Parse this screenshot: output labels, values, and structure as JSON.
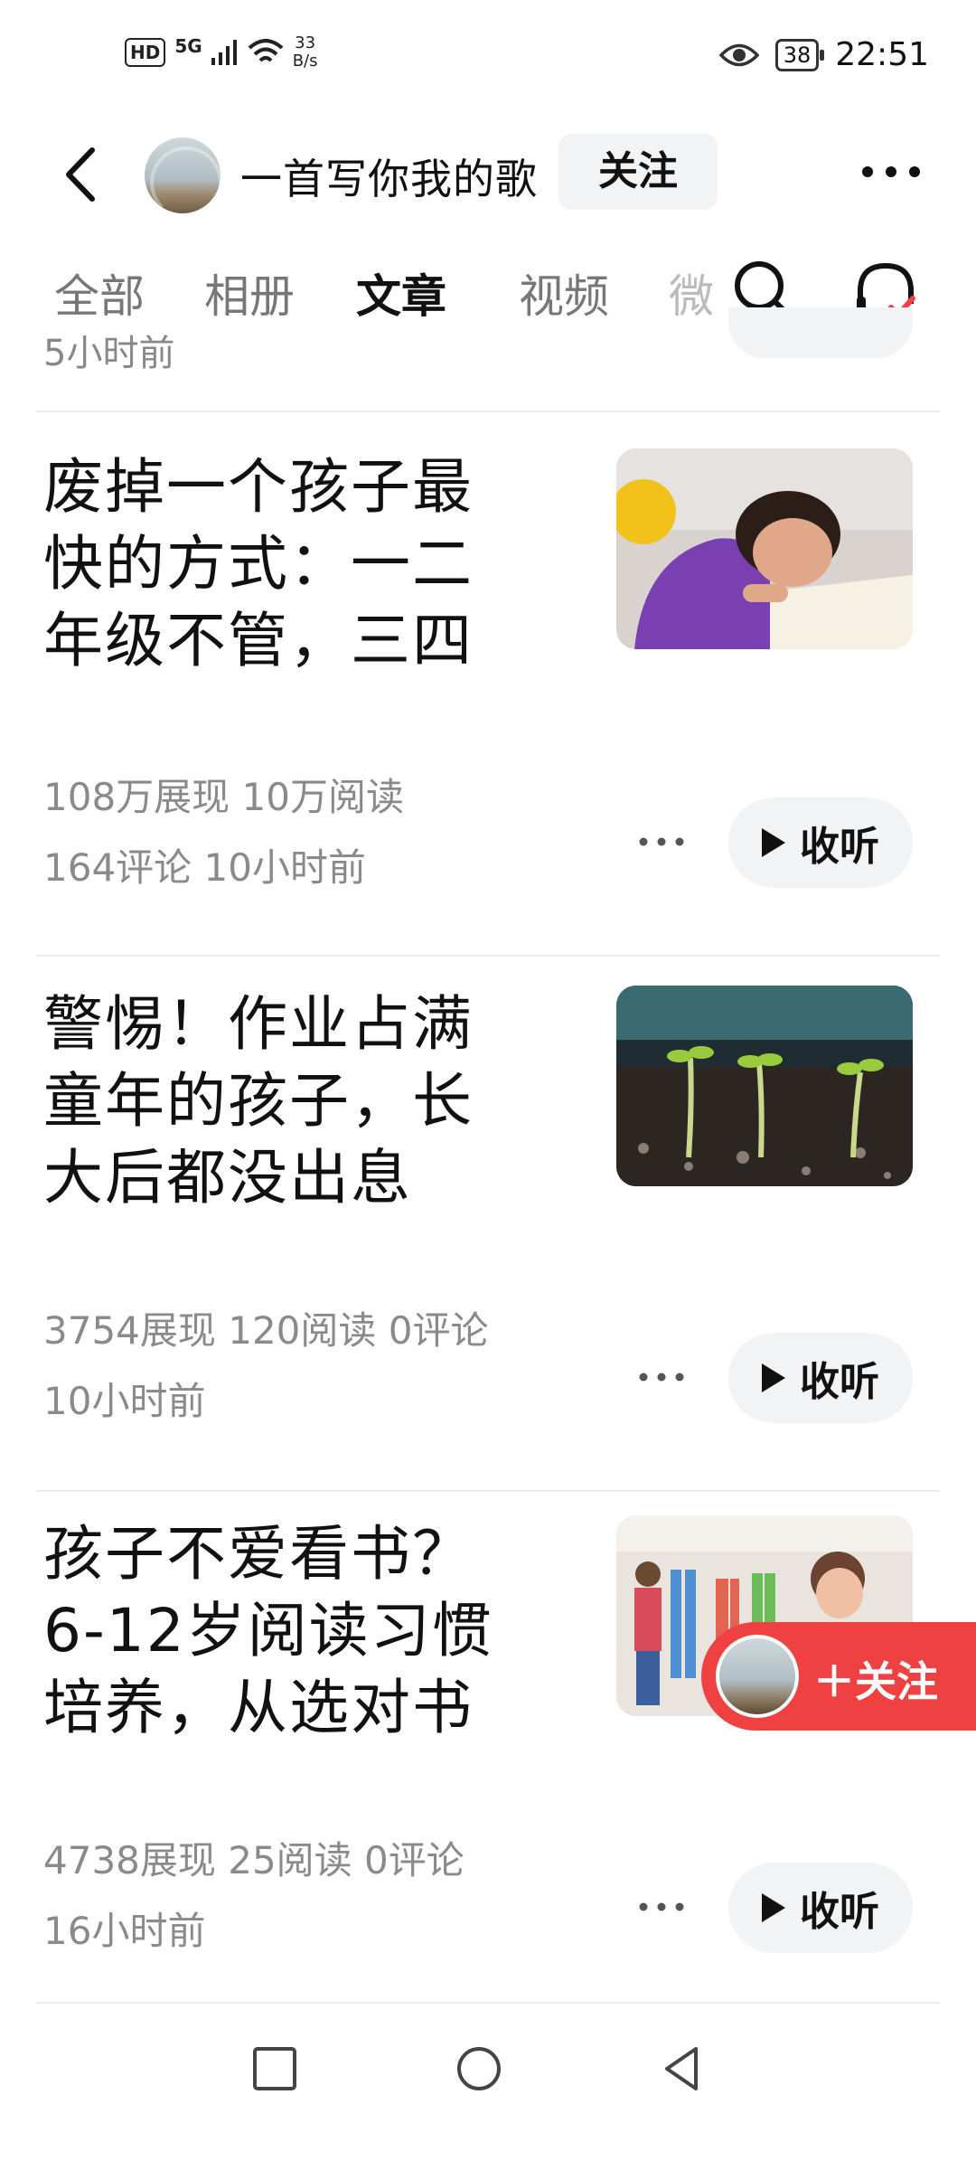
{
  "status_bar": {
    "hd": "HD",
    "signal": "5G",
    "net_speed": "33",
    "net_unit": "B/s",
    "battery": "38",
    "time": "22:51"
  },
  "header": {
    "profile_name": "一首写你我的歌",
    "follow_label": "关注"
  },
  "tabs": [
    "全部",
    "相册",
    "文章",
    "视频",
    "微"
  ],
  "active_tab": "文章",
  "previous_item": {
    "time": "5小时前"
  },
  "articles": [
    {
      "title_lines": [
        "废掉一个孩子最",
        "快的方式：一二",
        "年级不管，三四"
      ],
      "meta_line1": "108万展现  10万阅读",
      "meta_line2": "164评论  10小时前",
      "listen_label": "收听"
    },
    {
      "title_lines": [
        "警惕！作业占满",
        "童年的孩子，长",
        "大后都没出息"
      ],
      "meta_line1": "3754展现  120阅读  0评论",
      "meta_line2": "10小时前",
      "listen_label": "收听"
    },
    {
      "title_lines": [
        "孩子不爱看书？",
        "6-12岁阅读习惯",
        "培养，从选对书"
      ],
      "meta_line1": "4738展现  25阅读  0评论",
      "meta_line2": "16小时前",
      "listen_label": "收听"
    }
  ],
  "floating_follow": {
    "label": "＋关注"
  },
  "colors": {
    "accent_red": "#f04142",
    "meta_gray": "#8a8a8a",
    "pill_bg": "#f2f3f5"
  },
  "icons": [
    "back-arrow-icon",
    "more-icon",
    "search-icon",
    "headset-icon",
    "play-icon",
    "nav-square-icon",
    "nav-circle-icon",
    "nav-back-icon"
  ]
}
